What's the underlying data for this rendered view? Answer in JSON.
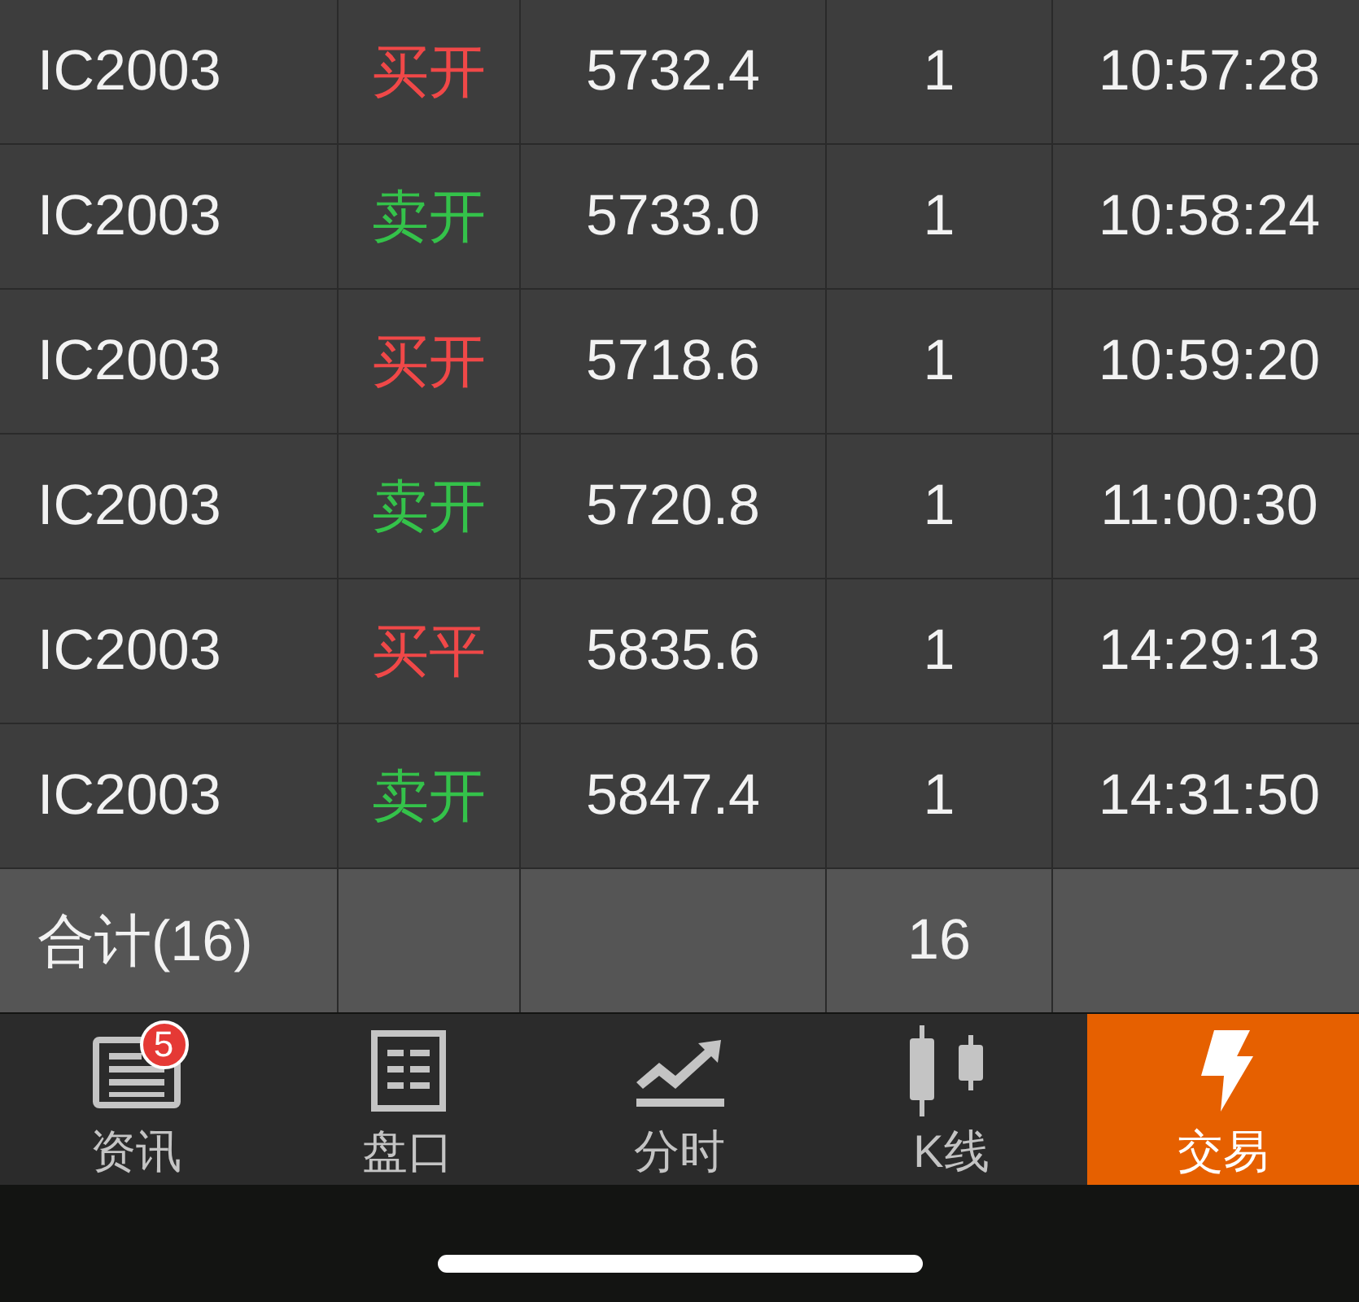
{
  "rows": [
    {
      "contract": "IC2003",
      "direction": {
        "text": "买开",
        "color": "#f04848"
      },
      "price": "5732.4",
      "quantity": "1",
      "time": "10:57:28"
    },
    {
      "contract": "IC2003",
      "direction": {
        "text": "卖开",
        "color": "#34c24a"
      },
      "price": "5733.0",
      "quantity": "1",
      "time": "10:58:24"
    },
    {
      "contract": "IC2003",
      "direction": {
        "text": "买开",
        "color": "#f04848"
      },
      "price": "5718.6",
      "quantity": "1",
      "time": "10:59:20"
    },
    {
      "contract": "IC2003",
      "direction": {
        "text": "卖开",
        "color": "#34c24a"
      },
      "price": "5720.8",
      "quantity": "1",
      "time": "11:00:30"
    },
    {
      "contract": "IC2003",
      "direction": {
        "text": "买平",
        "color": "#f04848"
      },
      "price": "5835.6",
      "quantity": "1",
      "time": "14:29:13"
    },
    {
      "contract": "IC2003",
      "direction": {
        "text": "卖开",
        "color": "#34c24a"
      },
      "price": "5847.4",
      "quantity": "1",
      "time": "14:31:50"
    }
  ],
  "total": {
    "label": "合计(16)",
    "quantity": "16"
  },
  "tabs": [
    {
      "label": "资讯",
      "selected": false,
      "badge": "5"
    },
    {
      "label": "盘口",
      "selected": false
    },
    {
      "label": "分时",
      "selected": false
    },
    {
      "label": "K线",
      "selected": false
    },
    {
      "label": "交易",
      "selected": true
    }
  ]
}
